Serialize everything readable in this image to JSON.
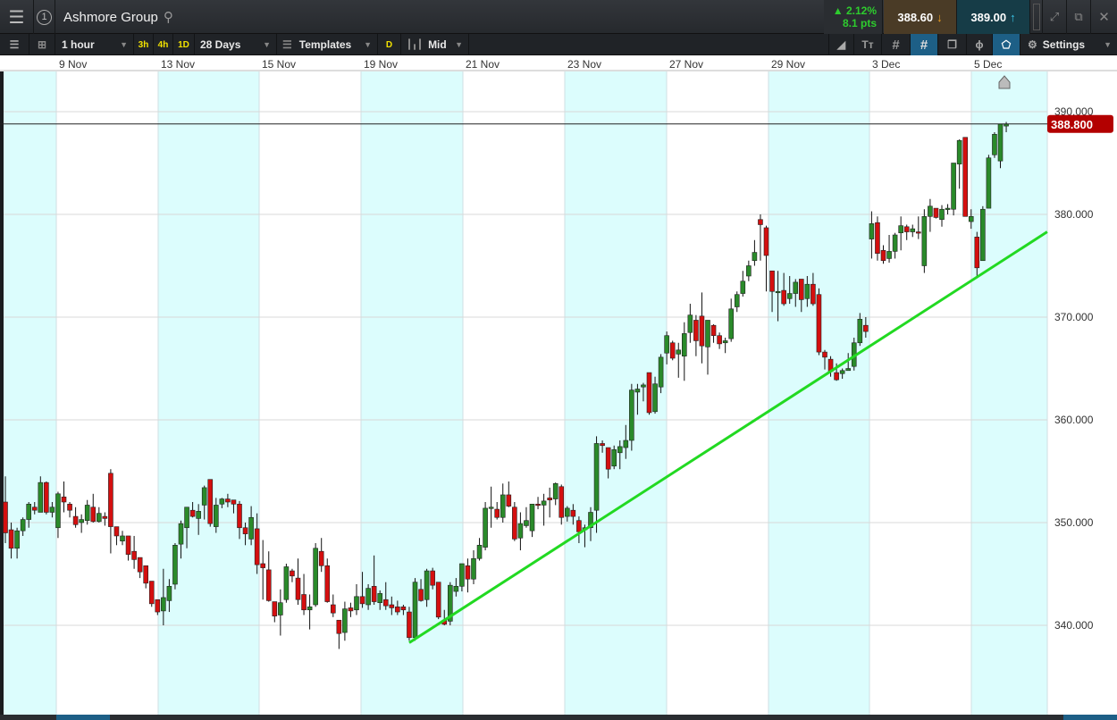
{
  "header": {
    "title": "Ashmore Group",
    "change_pct": "▲ 2.12%",
    "change_pts": "8.1 pts",
    "sell_price": "388.60",
    "buy_price": "389.00"
  },
  "toolbar": {
    "interval": "1 hour",
    "quick_3h": "3h",
    "quick_4h": "4h",
    "quick_1d": "1D",
    "range": "28 Days",
    "templates": "Templates",
    "d_button": "D",
    "price_type": "Mid",
    "settings": "Settings"
  },
  "colors": {
    "up": "#2a8a2a",
    "down": "#d40f0f",
    "trendline": "#22d922",
    "stripe": "#dcfdfd",
    "price_tag": "#b30000"
  },
  "chart_data": {
    "type": "candlestick",
    "instrument": "Ashmore Group",
    "x_tick_labels": [
      "9 Nov",
      "13 Nov",
      "15 Nov",
      "19 Nov",
      "21 Nov",
      "23 Nov",
      "27 Nov",
      "29 Nov",
      "3 Dec",
      "5 Dec"
    ],
    "y_tick_labels": [
      "390.000",
      "380.000",
      "370.000",
      "360.000",
      "350.000",
      "340.000"
    ],
    "y_ticks": [
      390,
      380,
      370,
      360,
      350,
      340
    ],
    "ylim": [
      331,
      394.5
    ],
    "current_price": 388.8,
    "current_price_label": "388.800",
    "trendline": {
      "start_index": 69,
      "start_price": 338.3,
      "end_index": 178,
      "end_price": 378.3
    },
    "ohlc": [
      [
        352,
        354.5,
        348,
        349
      ],
      [
        349.3,
        350,
        346.5,
        347.5
      ],
      [
        347.5,
        349.5,
        346.5,
        349.2
      ],
      [
        349.2,
        350.5,
        348.7,
        350.3
      ],
      [
        350.3,
        352,
        349.5,
        351.8
      ],
      [
        351.5,
        352,
        350.8,
        351.2
      ],
      [
        351,
        354.5,
        351,
        353.9
      ],
      [
        353.9,
        354,
        350.8,
        351
      ],
      [
        351,
        352,
        350.5,
        351.5
      ],
      [
        349.5,
        353,
        348.5,
        352.8
      ],
      [
        352.5,
        354,
        351,
        352
      ],
      [
        351.8,
        352,
        350.5,
        351.2
      ],
      [
        350.6,
        351.5,
        349.5,
        349.8
      ],
      [
        350,
        350.8,
        349,
        350.3
      ],
      [
        350.2,
        352.2,
        349.8,
        351.7
      ],
      [
        351.5,
        352.8,
        350,
        350.1
      ],
      [
        350.1,
        351.5,
        350,
        350.9
      ],
      [
        350.6,
        351,
        349.7,
        350.4
      ],
      [
        354.8,
        355.2,
        347,
        349.6
      ],
      [
        349.6,
        349.6,
        347.8,
        348.7
      ],
      [
        348.2,
        349.2,
        347.8,
        348.7
      ],
      [
        348.7,
        348.7,
        346.3,
        346.9
      ],
      [
        347.2,
        348.7,
        345.5,
        346.4
      ],
      [
        346.6,
        346.6,
        344.6,
        345.2
      ],
      [
        345.8,
        345.8,
        343.6,
        344.1
      ],
      [
        344.3,
        344.3,
        341.8,
        342.1
      ],
      [
        342.5,
        342.5,
        341,
        341.3
      ],
      [
        341.4,
        345.5,
        340,
        342.7
      ],
      [
        342.4,
        344.5,
        341.3,
        343.8
      ],
      [
        344,
        348,
        343.5,
        347.8
      ],
      [
        347.9,
        350.2,
        346.5,
        349.9
      ],
      [
        349.5,
        351.5,
        347.5,
        351.5
      ],
      [
        351.2,
        352,
        350.5,
        350.6
      ],
      [
        350.4,
        351.8,
        348.8,
        351.1
      ],
      [
        351.7,
        353.6,
        350.3,
        353.4
      ],
      [
        354.2,
        354.2,
        349.6,
        349.9
      ],
      [
        349.6,
        352.4,
        349,
        351.7
      ],
      [
        351.8,
        352.4,
        351.4,
        352.3
      ],
      [
        352.3,
        352.8,
        351.5,
        352
      ],
      [
        352.2,
        352.2,
        350.9,
        351.8
      ],
      [
        351.8,
        352.1,
        348.4,
        349.5
      ],
      [
        349.5,
        350,
        347.8,
        348.9
      ],
      [
        348.4,
        351.6,
        347.8,
        350.5
      ],
      [
        349.4,
        350.9,
        345,
        345.9
      ],
      [
        346,
        348.3,
        342.5,
        345.6
      ],
      [
        345.4,
        347.2,
        342.3,
        342.4
      ],
      [
        342.3,
        342.3,
        340.3,
        340.9
      ],
      [
        341,
        343.5,
        339,
        342.2
      ],
      [
        342.5,
        346,
        342.2,
        345.7
      ],
      [
        345.3,
        345.5,
        344.2,
        344.8
      ],
      [
        344.6,
        346.5,
        342,
        342.5
      ],
      [
        343,
        345,
        341,
        341.5
      ],
      [
        341.5,
        343,
        339.6,
        341.8
      ],
      [
        342,
        348,
        341.8,
        347.5
      ],
      [
        347.2,
        348.5,
        345.2,
        345.8
      ],
      [
        345.8,
        346.5,
        342.2,
        342.3
      ],
      [
        342,
        343,
        340.8,
        341.2
      ],
      [
        340.5,
        340.5,
        337.7,
        339.2
      ],
      [
        339.3,
        342.3,
        338.5,
        341.6
      ],
      [
        341.7,
        342.2,
        340.8,
        341.4
      ],
      [
        341.5,
        344,
        341,
        342.8
      ],
      [
        342.8,
        345.2,
        341.7,
        342.1
      ],
      [
        342,
        344,
        341.5,
        343.6
      ],
      [
        343.8,
        346.8,
        342,
        342.3
      ],
      [
        342.2,
        343.4,
        341.5,
        343.1
      ],
      [
        342.5,
        344.2,
        341.5,
        341.9
      ],
      [
        342,
        342.8,
        341,
        341.7
      ],
      [
        341.8,
        342.4,
        341,
        341.3
      ],
      [
        341.8,
        342,
        341,
        341.5
      ],
      [
        341.3,
        341.8,
        338.5,
        338.8
      ],
      [
        338.8,
        344.6,
        338.5,
        344.2
      ],
      [
        343.5,
        344.5,
        342.3,
        342.4
      ],
      [
        342.5,
        345.5,
        341.8,
        345.3
      ],
      [
        345.3,
        345.6,
        343.5,
        343.9
      ],
      [
        344.2,
        344.2,
        340.6,
        340.8
      ],
      [
        340.5,
        341.5,
        340,
        340.1
      ],
      [
        340.4,
        344.2,
        340,
        343.9
      ],
      [
        343.3,
        344.6,
        342.8,
        343.8
      ],
      [
        343.8,
        346,
        343.3,
        346
      ],
      [
        345.8,
        346.5,
        343.2,
        344.5
      ],
      [
        344.5,
        347.3,
        344,
        346.5
      ],
      [
        346.5,
        348.5,
        346.3,
        347.8
      ],
      [
        347.6,
        352,
        347.3,
        351.4
      ],
      [
        351.4,
        353.5,
        349.5,
        351.5
      ],
      [
        351.3,
        352,
        350.3,
        350.5
      ],
      [
        350.5,
        353.8,
        350,
        352.7
      ],
      [
        352.7,
        354,
        351.5,
        351.6
      ],
      [
        351.5,
        352,
        348.2,
        348.4
      ],
      [
        348.5,
        351,
        347.3,
        349.9
      ],
      [
        349.7,
        351.5,
        349.5,
        350.2
      ],
      [
        349.2,
        351.8,
        348.6,
        351.8
      ],
      [
        351.8,
        352.5,
        351.3,
        351.7
      ],
      [
        351.7,
        352.8,
        349.7,
        352.1
      ],
      [
        352.4,
        353.4,
        350.5,
        352.2
      ],
      [
        352.3,
        353.9,
        351.7,
        353.8
      ],
      [
        353.5,
        353.7,
        349.8,
        350.5
      ],
      [
        350.6,
        351.6,
        350.1,
        351.4
      ],
      [
        351.2,
        351.8,
        349.8,
        350.6
      ],
      [
        350.2,
        350.6,
        348,
        349.1
      ],
      [
        349.3,
        349.8,
        347.6,
        349.5
      ],
      [
        349.5,
        351.5,
        348.2,
        351
      ],
      [
        351.2,
        358.4,
        349,
        357.7
      ],
      [
        357.7,
        358,
        356.8,
        357.5
      ],
      [
        357.3,
        357.3,
        354.3,
        355.2
      ],
      [
        355.5,
        357.5,
        355.2,
        357.1
      ],
      [
        356.8,
        358,
        355.2,
        357.4
      ],
      [
        357.3,
        359.5,
        356.2,
        358
      ],
      [
        358,
        363.5,
        357,
        362.9
      ],
      [
        362.7,
        363.5,
        360.5,
        363
      ],
      [
        363.2,
        363.6,
        361.8,
        363.4
      ],
      [
        364.6,
        364.6,
        360.5,
        360.7
      ],
      [
        360.8,
        364.2,
        360.6,
        363.5
      ],
      [
        363.2,
        366.4,
        362.6,
        366.1
      ],
      [
        366.5,
        368.6,
        365.4,
        368.2
      ],
      [
        367.5,
        367.7,
        365.8,
        366
      ],
      [
        366.4,
        367.5,
        364.1,
        366.8
      ],
      [
        366.2,
        369.5,
        363.8,
        368.4
      ],
      [
        368.5,
        371.3,
        367.5,
        370.2
      ],
      [
        369.7,
        370.2,
        366.2,
        367.7
      ],
      [
        370.1,
        372.4,
        365.5,
        367.2
      ],
      [
        367.1,
        369.5,
        364.4,
        369.7
      ],
      [
        369.2,
        369.3,
        367.5,
        368.2
      ],
      [
        368.2,
        368.5,
        366.9,
        367.4
      ],
      [
        367.5,
        368,
        366.5,
        367.7
      ],
      [
        367.9,
        371.8,
        367.6,
        370.8
      ],
      [
        371,
        372.5,
        370.5,
        372.2
      ],
      [
        372.3,
        374.5,
        372,
        373.5
      ],
      [
        374,
        375.5,
        373.5,
        375
      ],
      [
        375.5,
        377.5,
        375,
        376.3
      ],
      [
        379.5,
        380,
        375.5,
        379
      ],
      [
        378.7,
        378.9,
        372.5,
        376
      ],
      [
        374.5,
        374.5,
        370.5,
        372.5
      ],
      [
        372.5,
        374.5,
        369.6,
        372.5
      ],
      [
        372.6,
        374.3,
        371.1,
        371.3
      ],
      [
        371.8,
        374,
        371.3,
        372.3
      ],
      [
        372.3,
        373.7,
        371,
        373.4
      ],
      [
        373.7,
        373.7,
        370.5,
        371.7
      ],
      [
        371.8,
        374,
        371,
        373.2
      ],
      [
        373.2,
        374.3,
        371.1,
        371.3
      ],
      [
        372.2,
        372.8,
        366.3,
        366.6
      ],
      [
        366.6,
        366.8,
        364.9,
        366.1
      ],
      [
        365.9,
        366.2,
        364.2,
        364.7
      ],
      [
        364.6,
        365.5,
        363.8,
        363.9
      ],
      [
        364.5,
        365,
        364,
        364.8
      ],
      [
        364.8,
        366.5,
        364.8,
        365
      ],
      [
        365.2,
        368,
        364.8,
        367.5
      ],
      [
        367.5,
        370.4,
        367.2,
        369.8
      ],
      [
        369.2,
        370,
        368,
        368.6
      ],
      [
        377.6,
        380.3,
        375.7,
        379.1
      ],
      [
        379.2,
        379.8,
        375.5,
        376.2
      ],
      [
        376.5,
        377,
        375.2,
        375.5
      ],
      [
        375.7,
        378,
        375.3,
        376.4
      ],
      [
        376.4,
        378.2,
        375.7,
        378
      ],
      [
        378.2,
        379.8,
        376.5,
        378.9
      ],
      [
        378.8,
        379,
        377.5,
        378.3
      ],
      [
        378.3,
        379,
        377.8,
        378.6
      ],
      [
        378.3,
        379.8,
        377.6,
        378.2
      ],
      [
        375,
        380.5,
        374.3,
        379.8
      ],
      [
        379.8,
        381.5,
        378.3,
        380.8
      ],
      [
        380.6,
        380.6,
        379.6,
        379.7
      ],
      [
        379.5,
        380.9,
        378.8,
        380.5
      ],
      [
        380.5,
        381,
        380,
        380.6
      ],
      [
        380.5,
        384.5,
        379.9,
        385
      ],
      [
        384.9,
        387.3,
        382.5,
        387.2
      ],
      [
        387.5,
        387.5,
        379.8,
        379.8
      ],
      [
        379.3,
        380.5,
        378.6,
        379.8
      ],
      [
        377.8,
        378.3,
        374,
        374.8
      ],
      [
        375.5,
        380.8,
        375.5,
        380.5
      ],
      [
        380.6,
        385.8,
        380.6,
        385.5
      ],
      [
        385.8,
        388,
        385.5,
        387.8
      ],
      [
        385.2,
        388.8,
        384.5,
        388.8
      ],
      [
        388.6,
        389,
        388,
        388.8
      ]
    ]
  }
}
